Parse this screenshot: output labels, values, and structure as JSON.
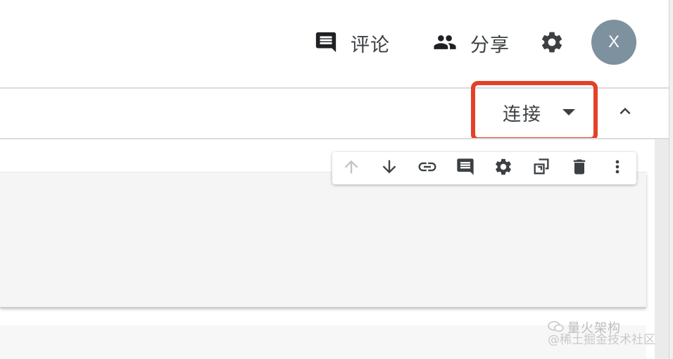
{
  "header": {
    "comment_label": "评论",
    "share_label": "分享",
    "avatar_initial": "X"
  },
  "toolbar": {
    "connect_label": "连接"
  },
  "cell_toolbar": {
    "icons": [
      "arrow-up-icon",
      "arrow-down-icon",
      "link-icon",
      "comment-icon",
      "gear-icon",
      "mirror-cell-icon",
      "trash-icon",
      "more-vert-icon"
    ]
  },
  "watermark": {
    "line1": "量火架构",
    "line2": "@稀土掘金技术社区"
  },
  "colors": {
    "highlight": "#e34128",
    "avatar": "#7d919e",
    "icon": "#3c4043",
    "icon_disabled": "#c4c4c4"
  }
}
